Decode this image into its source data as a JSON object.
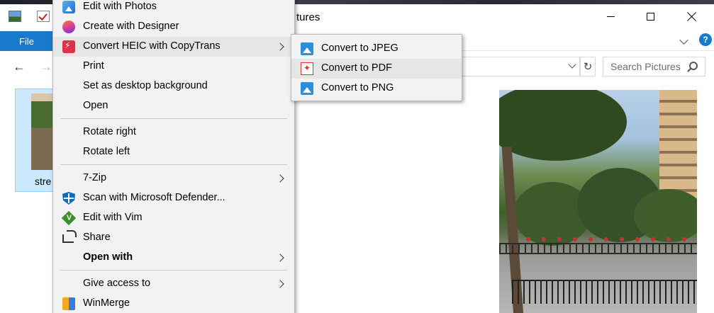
{
  "window": {
    "title_fragment": "tures",
    "ribbon_file_tab": "File",
    "help_glyph": "?",
    "search_placeholder": "Search Pictures",
    "file_name_fragment": "stre"
  },
  "context_menu": {
    "items": [
      {
        "label": "Edit with Photos",
        "icon": "photos-icon"
      },
      {
        "label": "Create with Designer",
        "icon": "designer-icon"
      },
      {
        "label": "Convert HEIC with CopyTrans",
        "icon": "copytrans-icon",
        "submenu": true,
        "highlighted": true
      },
      {
        "label": "Print"
      },
      {
        "label": "Set as desktop background"
      },
      {
        "label": "Open"
      },
      {
        "label": "Rotate right"
      },
      {
        "label": "Rotate left"
      },
      {
        "label": "7-Zip",
        "submenu": true
      },
      {
        "label": "Scan with Microsoft Defender...",
        "icon": "defender-shield-icon"
      },
      {
        "label": "Edit with Vim",
        "icon": "vim-icon"
      },
      {
        "label": "Share",
        "icon": "share-icon"
      },
      {
        "label": "Open with",
        "submenu": true,
        "bold": true
      },
      {
        "label": "Give access to",
        "submenu": true
      },
      {
        "label": "WinMerge",
        "icon": "winmerge-icon"
      }
    ]
  },
  "submenu": {
    "items": [
      {
        "label": "Convert to JPEG",
        "icon": "image-icon"
      },
      {
        "label": "Convert to PDF",
        "icon": "pdf-icon",
        "highlighted": true
      },
      {
        "label": "Convert to PNG",
        "icon": "image-icon"
      }
    ]
  },
  "colors": {
    "file_tab": "#1979ca",
    "selection": "#cce8ff",
    "menu_bg": "#f2f2f2",
    "menu_highlight": "#e6e6e6"
  }
}
